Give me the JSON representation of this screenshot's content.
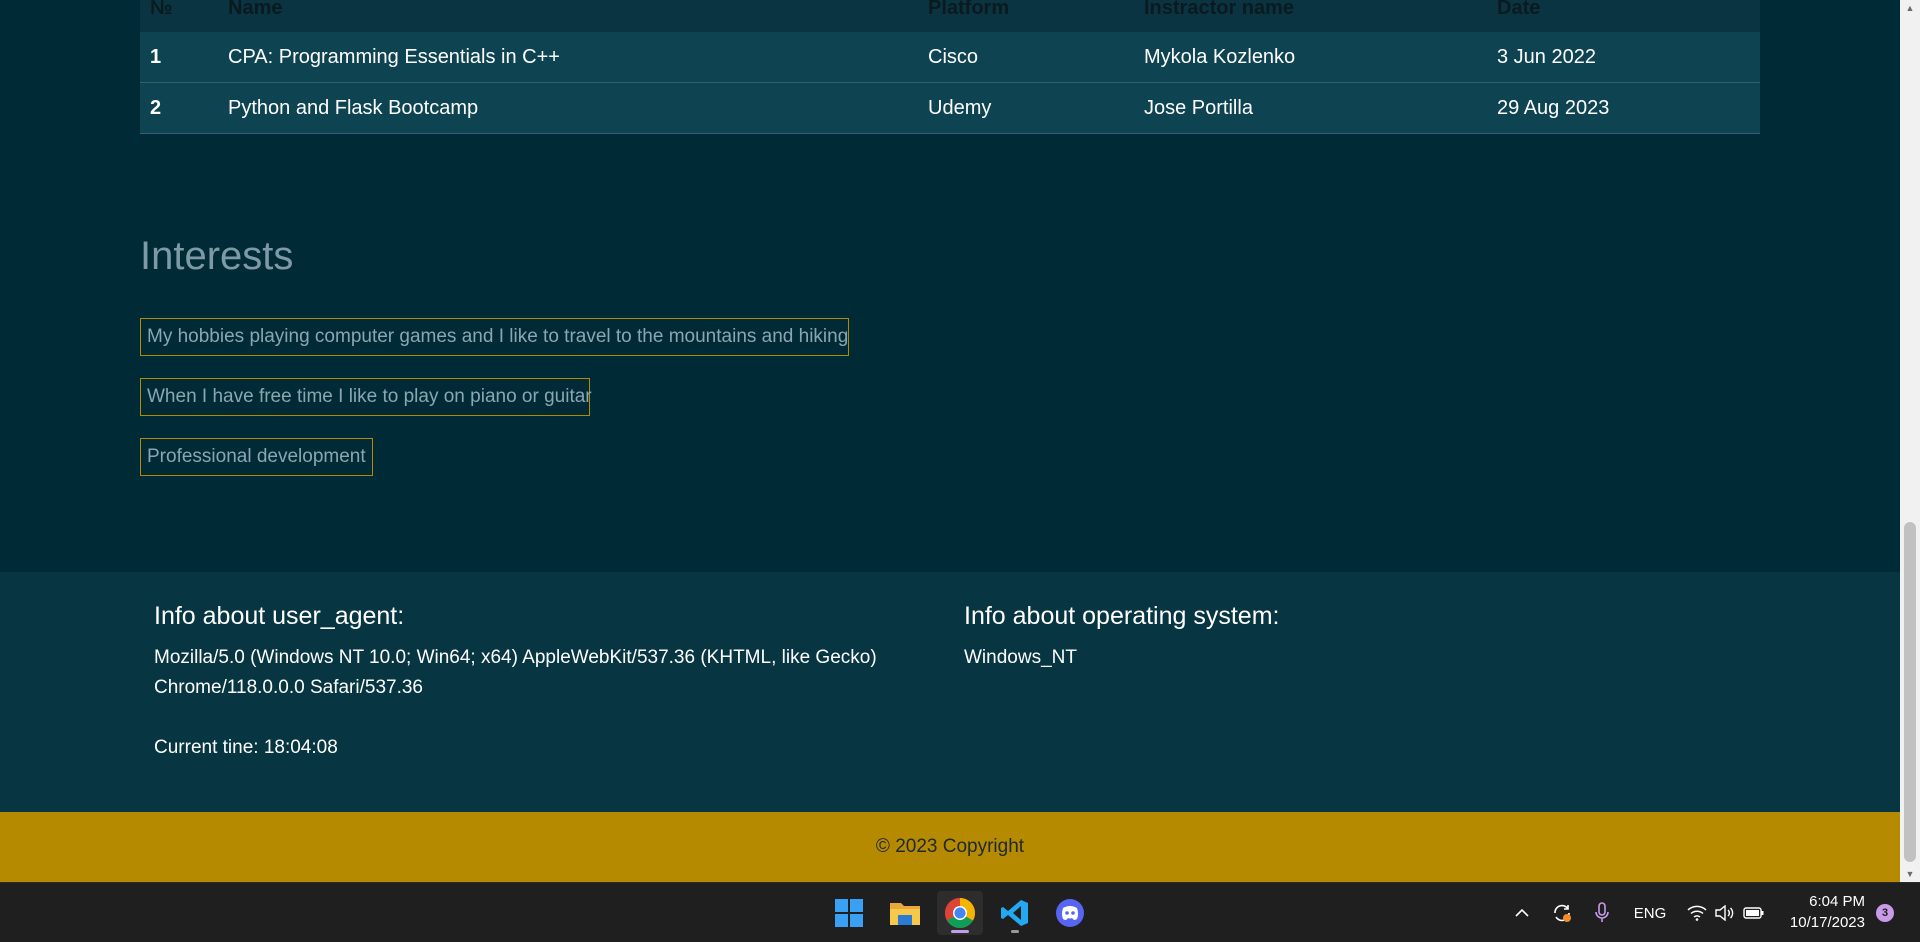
{
  "table": {
    "headers": [
      "№",
      "Name",
      "Platform",
      "Instractor name",
      "Date"
    ],
    "rows": [
      {
        "num": "1",
        "name": "CPA: Programming Essentials in C++",
        "platform": "Cisco",
        "instructor": "Mykola Kozlenko",
        "date": "3 Jun 2022"
      },
      {
        "num": "2",
        "name": "Python and Flask Bootcamp",
        "platform": "Udemy",
        "instructor": "Jose Portilla",
        "date": "29 Aug 2023"
      }
    ]
  },
  "interests": {
    "title": "Interests",
    "items": [
      "My hobbies playing computer games and I like to travel to the mountains and hiking",
      "When I have free time I like to play on piano or guitar",
      "Professional development"
    ]
  },
  "info": {
    "user_agent_title": "Info about user_agent:",
    "user_agent_line1": "Mozilla/5.0 (Windows NT 10.0; Win64; x64) AppleWebKit/537.36 (KHTML, like Gecko)",
    "user_agent_line2": "Chrome/118.0.0.0 Safari/537.36",
    "current_time": "Current tine: 18:04:08",
    "os_title": "Info about operating system:",
    "os_value": "Windows_NT"
  },
  "footer": {
    "copyright": "© 2023 Copyright"
  },
  "colors": {
    "page_bg": "#002b36",
    "info_bg": "#073642",
    "accent": "#b58900",
    "table_row": "#0e4452"
  },
  "taskbar": {
    "apps": [
      {
        "name": "windows-start",
        "icon": "windows-logo-icon"
      },
      {
        "name": "file-explorer",
        "icon": "folder-icon"
      },
      {
        "name": "chrome",
        "icon": "chrome-icon",
        "active": true
      },
      {
        "name": "vscode",
        "icon": "vscode-icon"
      },
      {
        "name": "discord",
        "icon": "discord-icon"
      }
    ],
    "language": "ENG",
    "time": "6:04 PM",
    "date": "10/17/2023",
    "notifications": "3"
  }
}
